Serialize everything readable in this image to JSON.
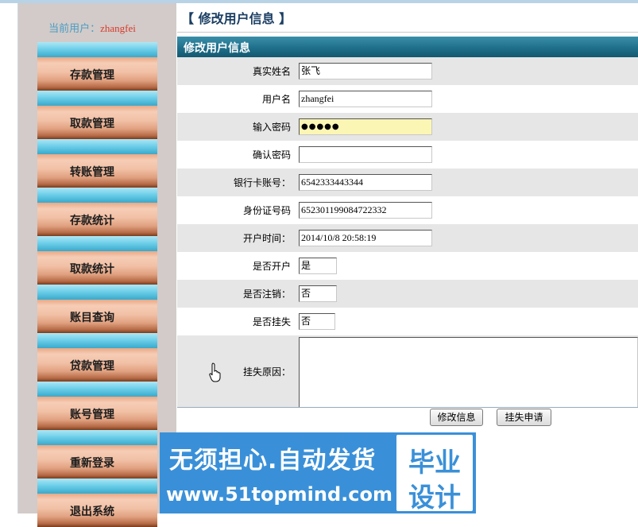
{
  "sidebar": {
    "current_user_label": "当前用户：",
    "current_user_name": "zhangfei",
    "items": [
      {
        "label": "存款管理"
      },
      {
        "label": "取款管理"
      },
      {
        "label": "转账管理"
      },
      {
        "label": "存款统计"
      },
      {
        "label": "取款统计"
      },
      {
        "label": "账目查询"
      },
      {
        "label": "贷款管理"
      },
      {
        "label": "账号管理"
      },
      {
        "label": "重新登录"
      },
      {
        "label": "退出系统"
      }
    ]
  },
  "main": {
    "title": "【 修改用户信息 】",
    "section_header": "修改用户信息",
    "fields": {
      "real_name": {
        "label": "真实姓名",
        "value": "张飞"
      },
      "username": {
        "label": "用户名",
        "value": "zhangfei"
      },
      "password": {
        "label": "输入密码",
        "value": "●●●●●"
      },
      "confirm_password": {
        "label": "确认密码",
        "value": ""
      },
      "bank_card": {
        "label": "银行卡账号：",
        "value": "6542333443344"
      },
      "id_number": {
        "label": "身份证号码",
        "value": "652301199084722332"
      },
      "open_time": {
        "label": "开户时间：",
        "value": "2014/10/8 20:58:19"
      },
      "is_opened": {
        "label": "是否开户",
        "value": "是"
      },
      "is_cancelled": {
        "label": "是否注销：",
        "value": "否"
      },
      "is_reported_lost": {
        "label": "是否挂失",
        "value": "否"
      },
      "loss_reason": {
        "label": "挂失原因：",
        "value": ""
      }
    },
    "buttons": {
      "modify": "修改信息",
      "report_loss": "挂失申请"
    }
  },
  "watermark": {
    "line1": "无须担心.自动发货",
    "line2": "www.51topmind.com",
    "box_line1": "毕业",
    "box_line2": "设计"
  }
}
